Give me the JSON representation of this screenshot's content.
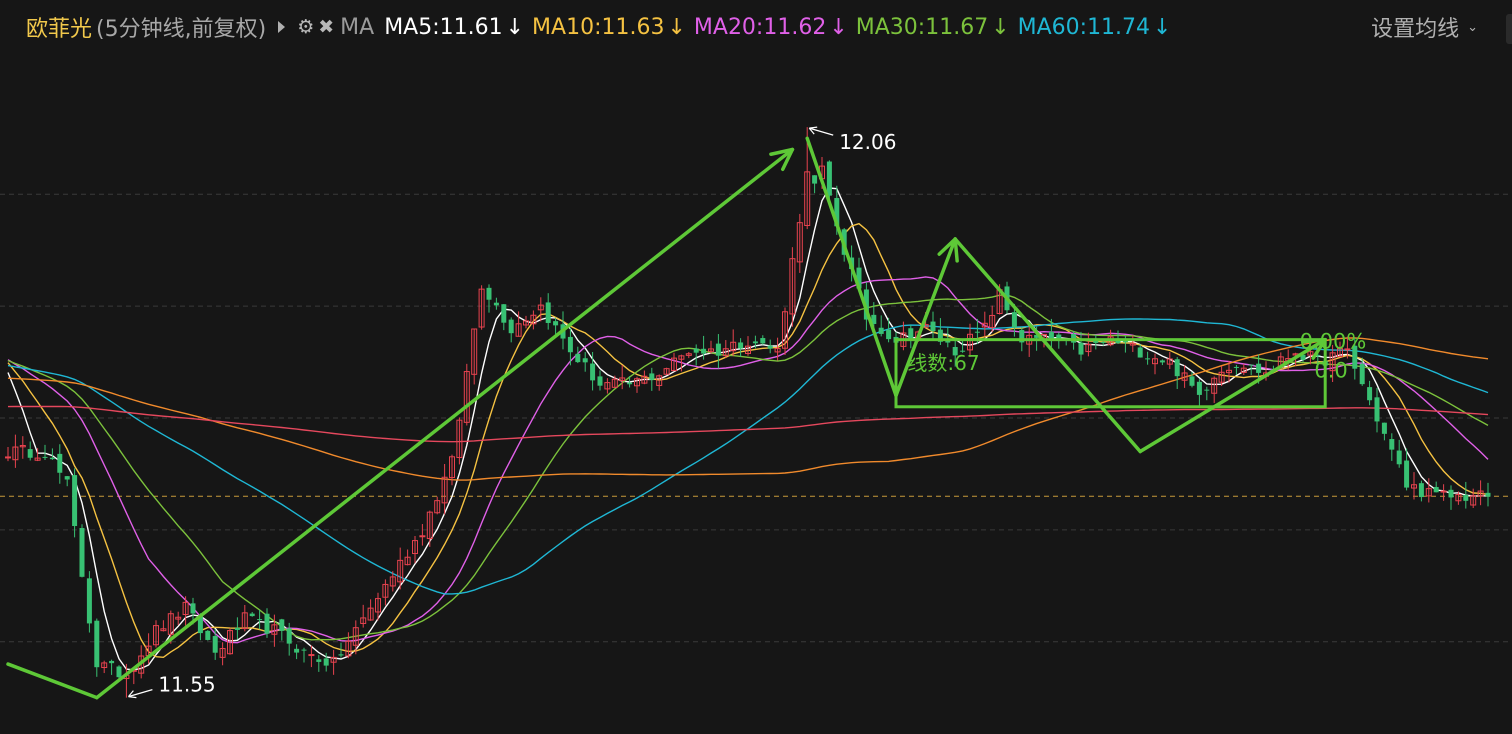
{
  "header": {
    "stock_name": "欧菲光",
    "period": "(5分钟线,前复权)",
    "ma_label": "MA",
    "settings_label": "设置均线",
    "ma_items": [
      {
        "label": "MA5:11.61",
        "arrow": "↓",
        "color": "#ffffff"
      },
      {
        "label": "MA10:11.63",
        "arrow": "↓",
        "color": "#f5c242"
      },
      {
        "label": "MA20:11.62",
        "arrow": "↓",
        "color": "#e060e8"
      },
      {
        "label": "MA30:11.67",
        "arrow": "↓",
        "color": "#7cc23c"
      },
      {
        "label": "MA60:11.74",
        "arrow": "↓",
        "color": "#1fb7d4"
      }
    ]
  },
  "chart_data": {
    "type": "candlestick",
    "ylim": [
      11.53,
      12.12
    ],
    "high_label": "12.06",
    "low_label": "11.55",
    "reference_price": 11.73,
    "grid": true,
    "colors": {
      "up": "#e8434f",
      "down": "#38c173",
      "drawing": "#5ec837",
      "reference": "#c79a3a"
    },
    "closes_hint": [
      [
        0,
        11.77
      ],
      [
        5,
        11.77
      ],
      [
        8,
        11.74
      ],
      [
        12,
        11.58
      ],
      [
        16,
        11.57
      ],
      [
        20,
        11.61
      ],
      [
        24,
        11.63
      ],
      [
        28,
        11.59
      ],
      [
        32,
        11.62
      ],
      [
        36,
        11.61
      ],
      [
        40,
        11.59
      ],
      [
        44,
        11.58
      ],
      [
        48,
        11.62
      ],
      [
        52,
        11.66
      ],
      [
        56,
        11.7
      ],
      [
        60,
        11.76
      ],
      [
        64,
        11.92
      ],
      [
        68,
        11.88
      ],
      [
        72,
        11.9
      ],
      [
        76,
        11.86
      ],
      [
        80,
        11.83
      ],
      [
        84,
        11.83
      ],
      [
        88,
        11.84
      ],
      [
        92,
        11.86
      ],
      [
        96,
        11.86
      ],
      [
        100,
        11.87
      ],
      [
        104,
        11.86
      ],
      [
        107,
        11.98
      ],
      [
        110,
        12.02
      ],
      [
        113,
        11.95
      ],
      [
        116,
        11.89
      ],
      [
        120,
        11.87
      ],
      [
        124,
        11.88
      ],
      [
        128,
        11.86
      ],
      [
        132,
        11.88
      ],
      [
        134,
        11.91
      ],
      [
        137,
        11.87
      ],
      [
        141,
        11.87
      ],
      [
        145,
        11.86
      ],
      [
        149,
        11.87
      ],
      [
        153,
        11.86
      ],
      [
        157,
        11.85
      ],
      [
        161,
        11.82
      ],
      [
        163,
        11.84
      ],
      [
        166,
        11.85
      ],
      [
        170,
        11.84
      ],
      [
        174,
        11.86
      ],
      [
        177,
        11.85
      ],
      [
        181,
        11.86
      ],
      [
        185,
        11.8
      ],
      [
        189,
        11.74
      ],
      [
        193,
        11.73
      ],
      [
        197,
        11.73
      ],
      [
        200,
        11.73
      ]
    ],
    "annotations": [
      {
        "text": "线数:67"
      },
      {
        "text": "0.00%"
      },
      {
        "text": "0.0"
      }
    ]
  }
}
